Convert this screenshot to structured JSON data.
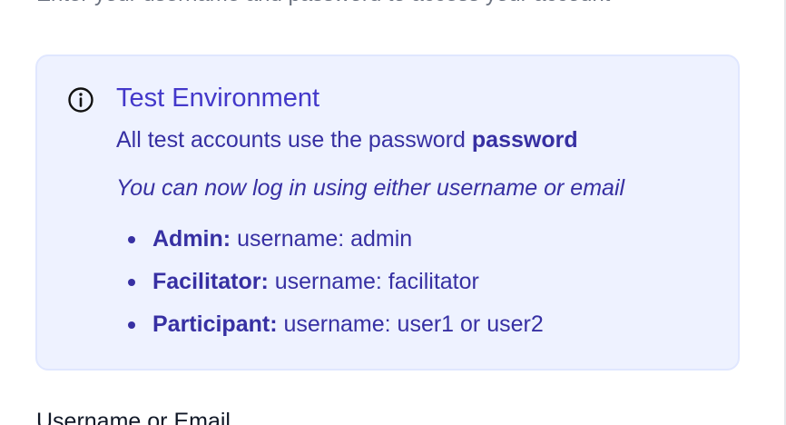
{
  "header": {
    "subtitle": "Enter your username and password to access your account"
  },
  "alert": {
    "icon": "info-circle-icon",
    "title": "Test Environment",
    "password_text": "All test accounts use the password",
    "password_value": "password",
    "login_note": "You can now log in using either username or email",
    "accounts": [
      {
        "role": "Admin:",
        "detail": "username: admin"
      },
      {
        "role": "Facilitator:",
        "detail": "username: facilitator"
      },
      {
        "role": "Participant:",
        "detail": "username: user1 or user2"
      }
    ],
    "colors": {
      "background": "#eef2ff",
      "border": "#e0e7ff",
      "title": "#4338ca",
      "text": "#3730a3"
    }
  },
  "form": {
    "username_label": "Username or Email"
  }
}
